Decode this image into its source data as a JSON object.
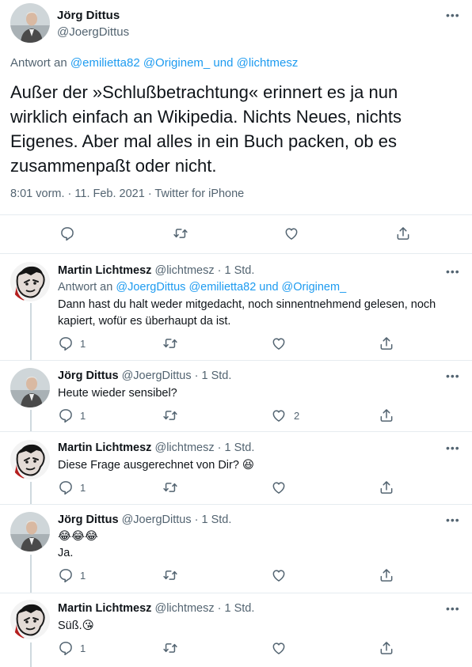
{
  "main_tweet": {
    "author_name": "Jörg Dittus",
    "author_handle": "@JoergDittus",
    "reply_prefix": "Antwort an",
    "reply_to": "@emilietta82 @Originem_ und @lichtmesz",
    "text": "Außer der »Schlußbetrachtung« erinnert es ja nun wirklich einfach an Wikipedia. Nichts Neues, nichts Eigenes. Aber mal alles in ein Buch packen, ob es zusammenpaßt oder nicht.",
    "meta_time": "8:01 vorm. · 11. Feb. 2021 · ",
    "meta_source": "Twitter for iPhone",
    "more_dots": "•••"
  },
  "replies": [
    {
      "name": "Martin Lichtmesz",
      "handle_time": "@lichtmesz · 1 Std.",
      "reply_prefix": "Antwort an",
      "reply_to": "@JoergDittus @emilietta82 und @Originem_",
      "text": "Dann hast du halt weder mitgedacht, noch sinnentnehmend gelesen, noch kapiert, wofür es überhaupt da ist.",
      "reply_count": "1",
      "like_count": "",
      "more_dots": "•••"
    },
    {
      "name": "Jörg Dittus",
      "handle_time": "@JoergDittus · 1 Std.",
      "text": "Heute wieder sensibel?",
      "reply_count": "1",
      "like_count": "2",
      "more_dots": "•••"
    },
    {
      "name": "Martin Lichtmesz",
      "handle_time": "@lichtmesz · 1 Std.",
      "text": "Diese Frage ausgerechnet von Dir? 😆",
      "reply_count": "1",
      "like_count": "",
      "more_dots": "•••"
    },
    {
      "name": "Jörg Dittus",
      "handle_time": "@JoergDittus · 1 Std.",
      "text": "😂😂😂",
      "text2": "Ja.",
      "reply_count": "1",
      "like_count": "",
      "more_dots": "•••"
    },
    {
      "name": "Martin Lichtmesz",
      "handle_time": "@lichtmesz · 1 Std.",
      "text": "Süß.😘",
      "reply_count": "1",
      "like_count": "",
      "more_dots": "•••"
    }
  ],
  "colors": {
    "link": "#1d9bf0",
    "muted": "#536471",
    "border": "#e6ecf0"
  }
}
